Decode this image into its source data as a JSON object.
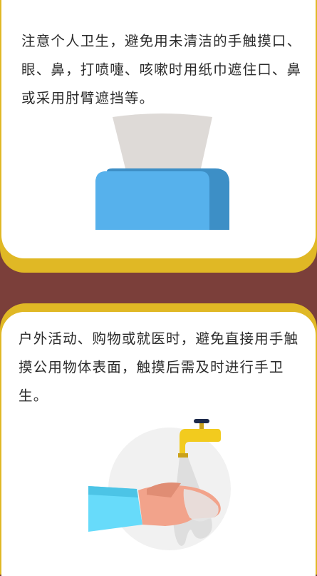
{
  "cards": [
    {
      "text": "注意个人卫生，避免用未清洁的手触摸口、眼、鼻，打喷嚏、咳嗽时用纸巾遮住口、鼻或采用肘臂遮挡等。",
      "illustration": "tissue-box-icon"
    },
    {
      "text": "户外活动、购物或就医时，避免直接用手触摸公用物体表面，触摸后需及时进行手卫生。",
      "illustration": "hand-washing-icon"
    }
  ],
  "colors": {
    "background": "#7b3f3a",
    "border": "#e0b825",
    "card": "#ffffff",
    "text": "#2b2b2b"
  }
}
